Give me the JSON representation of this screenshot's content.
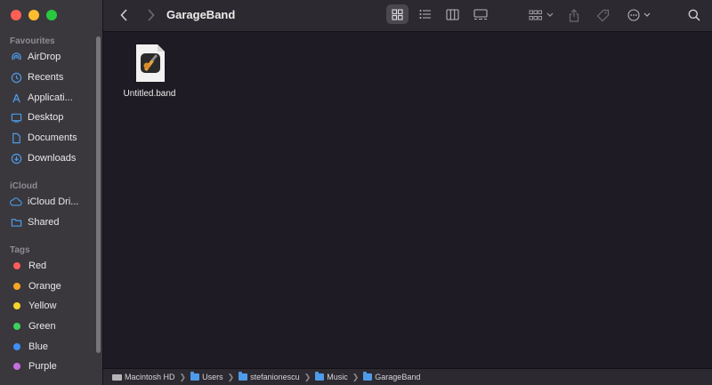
{
  "window": {
    "title": "GarageBand"
  },
  "sidebar": {
    "favourites_title": "Favourites",
    "favourites": [
      {
        "label": "AirDrop",
        "icon": "airdrop-icon"
      },
      {
        "label": "Recents",
        "icon": "clock-icon"
      },
      {
        "label": "Applicati...",
        "icon": "applications-icon"
      },
      {
        "label": "Desktop",
        "icon": "desktop-icon"
      },
      {
        "label": "Documents",
        "icon": "document-icon"
      },
      {
        "label": "Downloads",
        "icon": "download-icon"
      }
    ],
    "icloud_title": "iCloud",
    "icloud": [
      {
        "label": "iCloud Dri...",
        "icon": "cloud-icon"
      },
      {
        "label": "Shared",
        "icon": "shared-folder-icon"
      }
    ],
    "tags_title": "Tags",
    "tags": [
      {
        "label": "Red",
        "color": "#ff5b5b"
      },
      {
        "label": "Orange",
        "color": "#f5a623"
      },
      {
        "label": "Yellow",
        "color": "#f8d32c"
      },
      {
        "label": "Green",
        "color": "#3bd35b"
      },
      {
        "label": "Blue",
        "color": "#3e8ff5"
      },
      {
        "label": "Purple",
        "color": "#c56ee0"
      }
    ]
  },
  "files": [
    {
      "name": "Untitled.band"
    }
  ],
  "pathbar": [
    {
      "label": "Macintosh HD"
    },
    {
      "label": "Users"
    },
    {
      "label": "stefanionescu"
    },
    {
      "label": "Music"
    },
    {
      "label": "GarageBand"
    }
  ]
}
